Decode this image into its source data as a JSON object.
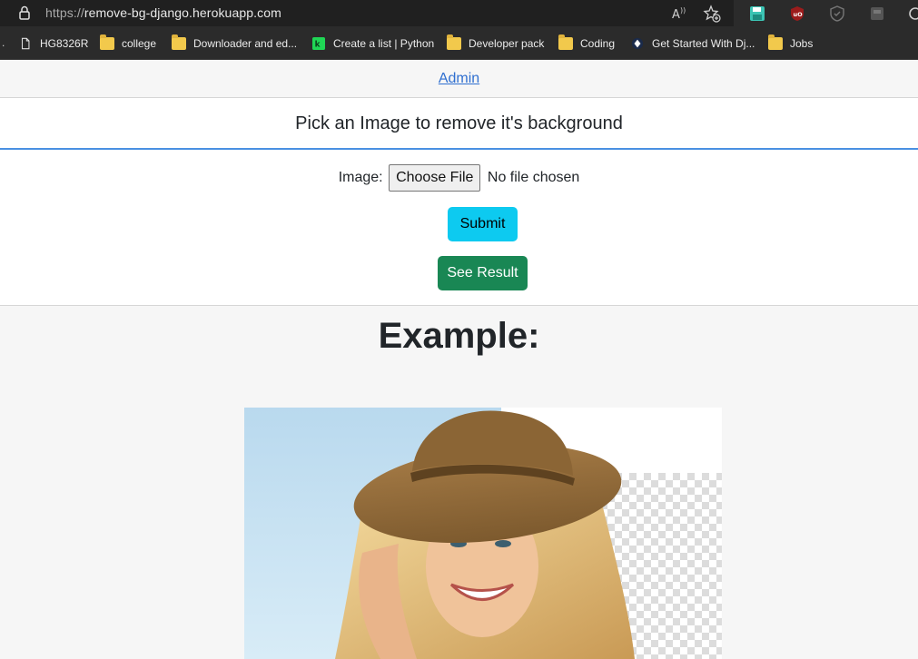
{
  "browser": {
    "url_protocol": "https://",
    "url_host": "remove-bg-django.herokuapp.com",
    "bookmarks": [
      {
        "label": "HG8326R",
        "icon": "page-icon"
      },
      {
        "label": "college",
        "icon": "folder-icon"
      },
      {
        "label": "Downloader and ed...",
        "icon": "folder-icon"
      },
      {
        "label": "Create a list | Python",
        "icon": "python-site-icon"
      },
      {
        "label": "Developer pack",
        "icon": "folder-icon"
      },
      {
        "label": "Coding",
        "icon": "folder-icon"
      },
      {
        "label": "Get Started With Dj...",
        "icon": "site-icon"
      },
      {
        "label": "Jobs",
        "icon": "folder-icon"
      }
    ]
  },
  "nav": {
    "admin_link": "Admin"
  },
  "upload_card": {
    "heading": "Pick an Image to remove it's background",
    "image_label": "Image:",
    "choose_file_label": "Choose File",
    "file_status": "No file chosen",
    "submit_label": "Submit",
    "see_result_label": "See Result"
  },
  "example": {
    "title": "Example:"
  },
  "colors": {
    "link": "#2f6fd0",
    "header_underline": "#4a90e2",
    "submit_bg": "#0dcaf0",
    "result_bg": "#198754",
    "page_bg": "#f6f6f6"
  }
}
